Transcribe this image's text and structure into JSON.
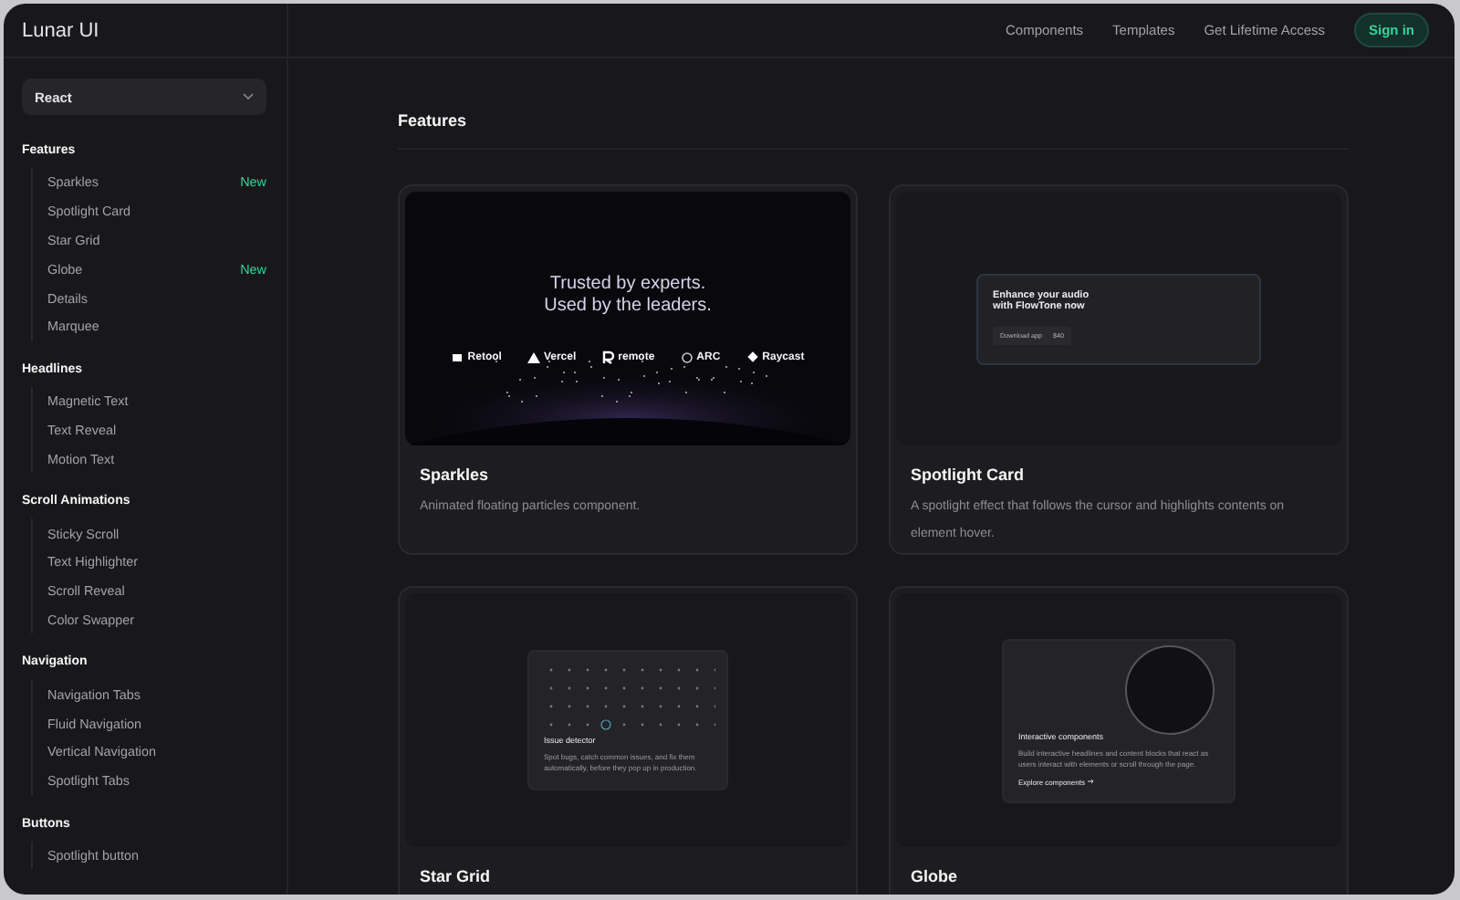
{
  "header": {
    "logo": "Lunar UI",
    "nav": [
      "Components",
      "Templates",
      "Get Lifetime Access"
    ],
    "sign_in": "Sign in"
  },
  "sidebar": {
    "framework_select": {
      "value": "React"
    },
    "sections": [
      {
        "title": "Features",
        "items": [
          {
            "label": "Sparkles",
            "badge": "New"
          },
          {
            "label": "Spotlight Card"
          },
          {
            "label": "Star Grid"
          },
          {
            "label": "Globe",
            "badge": "New"
          },
          {
            "label": "Details"
          },
          {
            "label": "Marquee"
          }
        ]
      },
      {
        "title": "Headlines",
        "items": [
          {
            "label": "Magnetic Text"
          },
          {
            "label": "Text Reveal"
          },
          {
            "label": "Motion Text"
          }
        ]
      },
      {
        "title": "Scroll Animations",
        "items": [
          {
            "label": "Sticky Scroll"
          },
          {
            "label": "Text Highlighter"
          },
          {
            "label": "Scroll Reveal"
          },
          {
            "label": "Color Swapper"
          }
        ]
      },
      {
        "title": "Navigation",
        "items": [
          {
            "label": "Navigation Tabs"
          },
          {
            "label": "Fluid Navigation"
          },
          {
            "label": "Vertical Navigation"
          },
          {
            "label": "Spotlight Tabs"
          }
        ]
      },
      {
        "title": "Buttons",
        "items": [
          {
            "label": "Spotlight button"
          }
        ]
      }
    ]
  },
  "main": {
    "heading": "Features",
    "cards": [
      {
        "kind": "sparkles",
        "title": "Sparkles",
        "description": "Animated floating particles component.",
        "preview": {
          "headline_lines": [
            "Trusted by experts.",
            "Used by the leaders."
          ],
          "logos": [
            "Retool",
            "Vercel",
            "remote",
            "ARC",
            "Raycast"
          ]
        }
      },
      {
        "kind": "spotlight",
        "title": "Spotlight Card",
        "description": "A spotlight effect that follows the cursor and highlights contents on element hover.",
        "preview": {
          "title_lines": [
            "Enhance your audio",
            "with FlowTone now"
          ],
          "button": "Download app",
          "price": "$40"
        }
      },
      {
        "kind": "star_grid",
        "title": "Star Grid",
        "preview": {
          "title": "Issue detector",
          "text": "Spot bugs, catch common issues, and fix them automatically, before they pop up in production."
        }
      },
      {
        "kind": "globe",
        "title": "Globe",
        "preview": {
          "title": "Interactive components",
          "text": "Build interactive headlines and content blocks that react as users interact with elements or scroll through the page.",
          "link": "Explore components"
        }
      }
    ]
  }
}
